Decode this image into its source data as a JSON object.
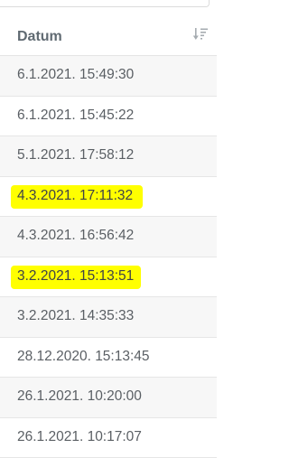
{
  "table": {
    "header": {
      "label": "Datum"
    },
    "rows": [
      {
        "value": "6.1.2021. 15:49:30",
        "highlighted": false
      },
      {
        "value": "6.1.2021. 15:45:22",
        "highlighted": false
      },
      {
        "value": "5.1.2021. 17:58:12",
        "highlighted": false
      },
      {
        "value": "4.3.2021. 17:11:32",
        "highlighted": true
      },
      {
        "value": "4.3.2021. 16:56:42",
        "highlighted": false
      },
      {
        "value": "3.2.2021. 15:13:51",
        "highlighted": true
      },
      {
        "value": "3.2.2021. 14:35:33",
        "highlighted": false
      },
      {
        "value": "28.12.2020. 15:13:45",
        "highlighted": false
      },
      {
        "value": "26.1.2021. 10:20:00",
        "highlighted": false
      },
      {
        "value": "26.1.2021. 10:17:07",
        "highlighted": false
      }
    ]
  },
  "colors": {
    "highlight": "#ffff00",
    "header_text": "#606a72",
    "cell_text": "#5a5f64",
    "stripe": "#f7f7f7"
  },
  "icons": {
    "sort": "sort-descending-icon"
  }
}
